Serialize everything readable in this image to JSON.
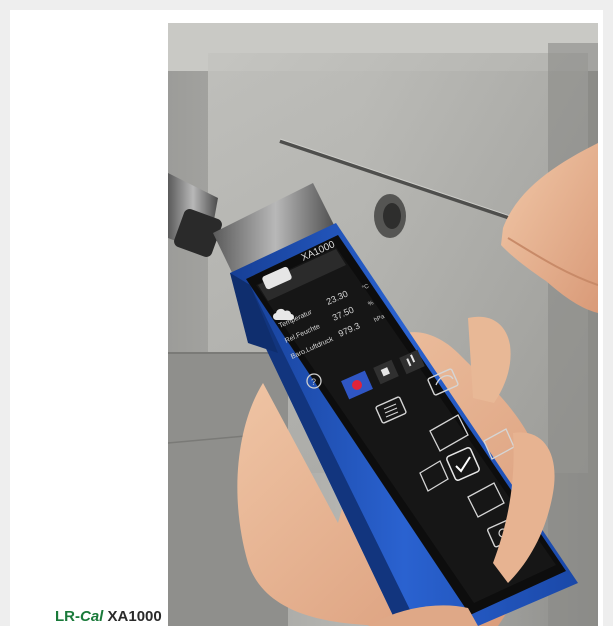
{
  "caption": {
    "brand_prefix": "LR-",
    "brand_italic": "Cal",
    "model": "XA1000"
  },
  "device": {
    "brand_label": "XA1000",
    "readings": [
      {
        "name": "Temperatur",
        "value": "23.30",
        "unit": "°C"
      },
      {
        "name": "Rel.Feuchte",
        "value": "37.50",
        "unit": "%"
      },
      {
        "name": "Baro.Luftdruck",
        "value": "979.3",
        "unit": "hPa"
      }
    ]
  },
  "colors": {
    "device_blue": "#1f56c4",
    "screen": "#161616",
    "caption_green": "#1a7a3a",
    "wall": "#a9a9a6"
  }
}
